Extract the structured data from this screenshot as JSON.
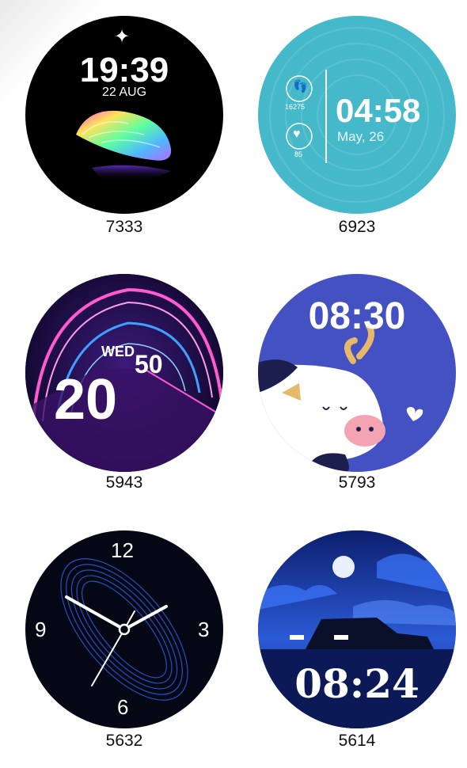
{
  "faces": [
    {
      "id": "7333",
      "time": "19:39",
      "date": "22 AUG"
    },
    {
      "id": "6923",
      "time": "04:58",
      "date": "May, 26",
      "steps": "16275",
      "heart": "85"
    },
    {
      "id": "5943",
      "day": "WED",
      "minutes": "50",
      "hour": "20"
    },
    {
      "id": "5793",
      "time": "08:30"
    },
    {
      "id": "5632",
      "numerals": [
        "12",
        "3",
        "6",
        "9"
      ]
    },
    {
      "id": "5614",
      "time": "08:24"
    }
  ],
  "colors": {
    "face_black": "#000000",
    "teal": "#45b9c9",
    "cow_blue": "#4451c2",
    "night_blue": "#1b3aa8",
    "neon_pink": "#ff5ad0",
    "neon_blue": "#3fa0ff"
  }
}
